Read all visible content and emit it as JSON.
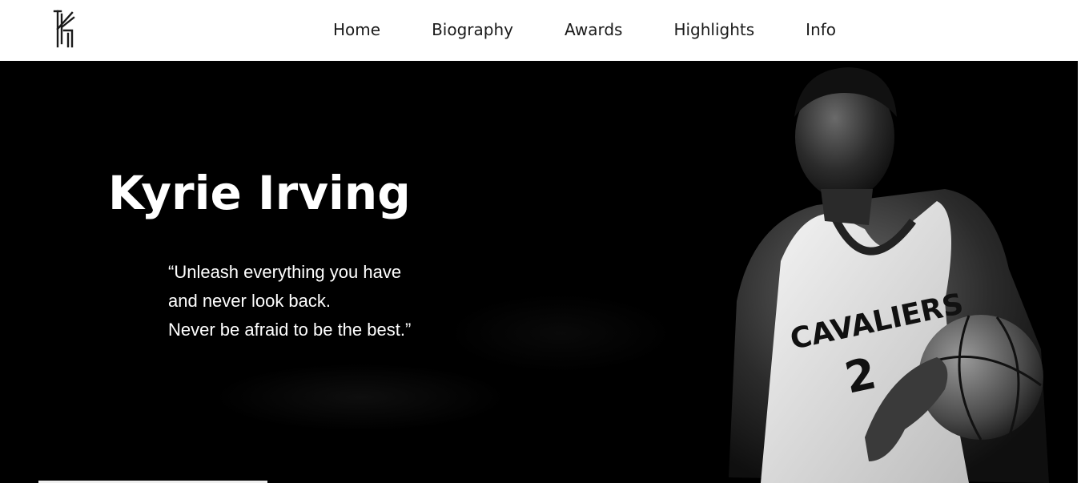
{
  "nav": {
    "items": [
      {
        "label": "Home"
      },
      {
        "label": "Biography"
      },
      {
        "label": "Awards"
      },
      {
        "label": "Highlights"
      },
      {
        "label": "Info"
      }
    ]
  },
  "logo": {
    "icon": "kyrie-logo-icon"
  },
  "hero": {
    "title": "Kyrie Irving",
    "quote_lines": [
      "“Unleash everything you have",
      "and never look back.",
      "Never be afraid to be the best.”"
    ],
    "image": {
      "icon": "player-photo",
      "jersey_text": "CAVALIERS",
      "jersey_number": "2"
    }
  },
  "colors": {
    "header_bg": "#ffffff",
    "hero_bg": "#000000",
    "text_light": "#ffffff",
    "nav_text": "#1a1a1a"
  }
}
